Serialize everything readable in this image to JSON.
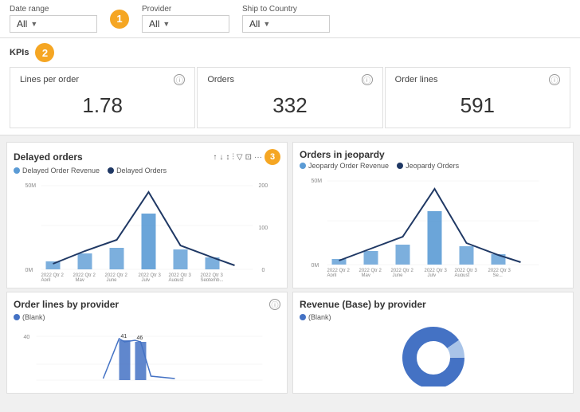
{
  "filters": {
    "dateRange": {
      "label": "Date range",
      "value": "All"
    },
    "provider": {
      "label": "Provider",
      "value": "All"
    },
    "shipToCountry": {
      "label": "Ship to Country",
      "value": "All"
    }
  },
  "badges": [
    {
      "id": 1,
      "value": "1"
    },
    {
      "id": 2,
      "value": "2"
    },
    {
      "id": 3,
      "value": "3"
    }
  ],
  "kpis": {
    "label": "KPIs",
    "cards": [
      {
        "title": "Lines per order",
        "value": "1.78"
      },
      {
        "title": "Orders",
        "value": "332"
      },
      {
        "title": "Order lines",
        "value": "591"
      }
    ]
  },
  "charts": {
    "delayedOrders": {
      "title": "Delayed orders",
      "legend": [
        {
          "label": "Delayed Order Revenue",
          "color": "#5b9bd5"
        },
        {
          "label": "Delayed Orders",
          "color": "#1f3864"
        }
      ],
      "yAxisLeft": [
        "50M",
        "0M"
      ],
      "yAxisRight": [
        "200",
        "100",
        "0"
      ],
      "xLabels": [
        "2022 Qtr 2\nApril",
        "2022 Qtr 2\nMay",
        "2022 Qtr 2\nJune",
        "2022 Qtr 3\nJuly",
        "2022 Qtr 3\nAugust",
        "2022 Qtr 3\nSeptemb..."
      ]
    },
    "ordersInJeopardy": {
      "title": "Orders in jeopardy",
      "legend": [
        {
          "label": "Jeopardy Order Revenue",
          "color": "#5b9bd5"
        },
        {
          "label": "Jeopardy Orders",
          "color": "#1f3864"
        }
      ],
      "yAxisLeft": [
        "50M",
        "0M"
      ],
      "xLabels": [
        "2022 Qtr 2\nApril",
        "2022 Qtr 2\nMay",
        "2022 Qtr 2\nJune",
        "2022 Qtr 3\nJuly",
        "2022 Qtr 3\nAugust",
        "2022 Qtr 3\nSe..."
      ]
    }
  },
  "bottomCharts": {
    "orderLinesByProvider": {
      "title": "Order lines by provider",
      "legend": "(Blank)",
      "yValue": "40",
      "barLabels": [
        "41",
        "46"
      ]
    },
    "revenueByProvider": {
      "title": "Revenue (Base) by provider",
      "legend": "(Blank)"
    }
  }
}
